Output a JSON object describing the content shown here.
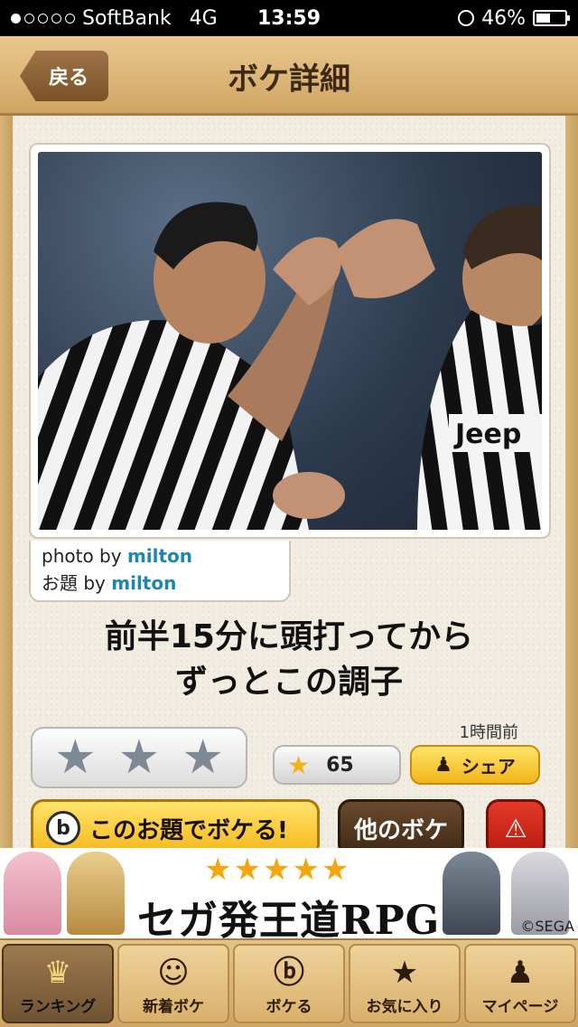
{
  "status_bar": {
    "carrier": "SoftBank",
    "network": "4G",
    "time": "13:59",
    "battery": "46%",
    "battery_level": 0.46,
    "signal_bars_on": 1
  },
  "nav": {
    "back_label": "戻る",
    "title": "ボケ詳細"
  },
  "photo_card": {
    "photo_by_prefix": "photo by ",
    "photo_by_user": "milton",
    "odai_by_prefix": "お題 by ",
    "odai_by_user": "milton"
  },
  "boke": {
    "line1": "前半15分に頭打ってから",
    "line2": "ずっとこの調子",
    "time_ago": "1時間前",
    "rating_stars": 3,
    "favorite_count": "65"
  },
  "actions": {
    "share_label": "シェア",
    "boke_this_label": "このお題でボケる!",
    "other_boke_label": "他のボケ"
  },
  "ad": {
    "stars": "★★★★★",
    "text": "セガ発王道RPG",
    "copyright": "©SEGA"
  },
  "tabs": [
    {
      "label": "ランキング",
      "icon": "crown-icon",
      "active": true
    },
    {
      "label": "新着ボケ",
      "icon": "face-icon",
      "active": false
    },
    {
      "label": "ボケる",
      "icon": "b-logo-icon",
      "active": false
    },
    {
      "label": "お気に入り",
      "icon": "star-icon",
      "active": false
    },
    {
      "label": "マイページ",
      "icon": "person-icon",
      "active": false
    }
  ],
  "colors": {
    "accent_yellow": "#f4b81b",
    "wood": "#d9b06a",
    "link_blue": "#1f86ad",
    "report_red": "#c8241a"
  }
}
